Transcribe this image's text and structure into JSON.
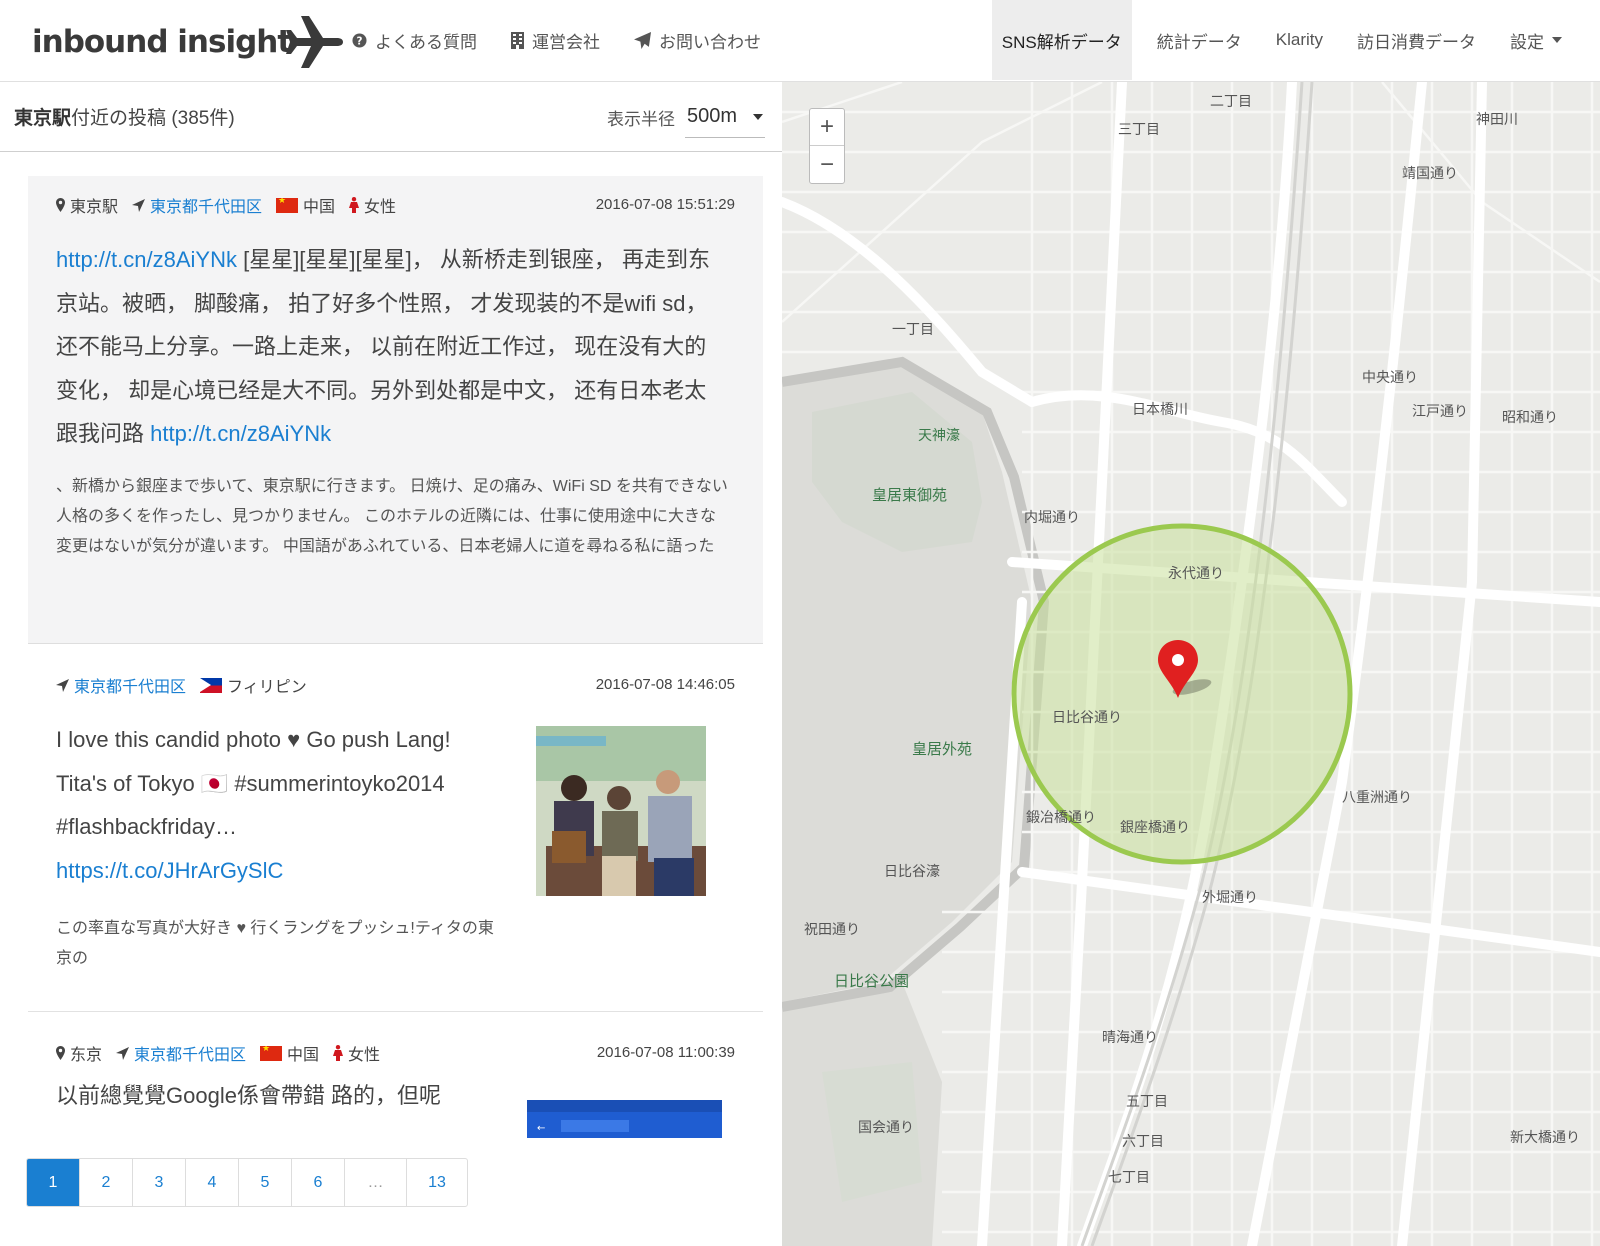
{
  "header": {
    "logo_text": "inbound insight",
    "nav_left": [
      {
        "label": "よくある質問",
        "icon": "question-circle-icon"
      },
      {
        "label": "運営会社",
        "icon": "building-icon"
      },
      {
        "label": "お問い合わせ",
        "icon": "paper-plane-icon"
      }
    ],
    "nav_right": [
      {
        "label": "SNS解析データ",
        "active": true
      },
      {
        "label": "統計データ"
      },
      {
        "label": "Klarity"
      },
      {
        "label": "訪日消費データ"
      },
      {
        "label": "設定",
        "dropdown": true
      }
    ]
  },
  "list": {
    "station": "東京駅",
    "title_suffix": "付近の投稿",
    "count": "(385件)",
    "radius_label": "表示半径",
    "radius_value": "500m"
  },
  "posts": [
    {
      "place": "東京駅",
      "area": "東京都千代田区",
      "country": "中国",
      "gender": "女性",
      "date": "2016-07-08 15:51:29",
      "link1": "http://t.cn/z8AiYNk",
      "text": " [星星][星星][星星]， 从新桥走到银座， 再走到东京站。被晒， 脚酸痛， 拍了好多个性照， 才发现装的不是wifi sd， 还不能马上分享。一路上走来， 以前在附近工作过， 现在没有大的变化， 却是心境已经是大不同。另外到处都是中文， 还有日本老太跟我问路 ",
      "link2": "http://t.cn/z8AiYNk",
      "translation": "、新橋から銀座まで歩いて、東京駅に行きます。 日焼け、足の痛み、WiFi SD を共有できない人格の多くを作ったし、見つかりません。 このホテルの近隣には、仕事に使用途中に大きな変更はないが気分が違います。 中国語があふれている、日本老婦人に道を尋ねる私に語った"
    },
    {
      "area": "東京都千代田区",
      "country": "フィリピン",
      "date": "2016-07-08 14:46:05",
      "text": "I love this candid photo ♥ Go push Lang! Tita's of Tokyo 🇯🇵 #summerintoyko2014 #flashbackfriday… ",
      "link": "https://t.co/JHrArGySlC",
      "translation": "この率直な写真が大好き ♥ 行くラングをプッシュ!ティタの東京の"
    },
    {
      "place": "东京",
      "area": "東京都千代田区",
      "country": "中国",
      "gender": "女性",
      "date": "2016-07-08 11:00:39",
      "text": "以前總覺覺Google係會帶錯 路的，但呢"
    }
  ],
  "pagination": [
    "1",
    "2",
    "3",
    "4",
    "5",
    "6",
    "…",
    "13"
  ],
  "map": {
    "zoom_in": "+",
    "zoom_out": "−",
    "labels": [
      {
        "text": "皇居東御苑"
      },
      {
        "text": "天神濠"
      },
      {
        "text": "皇居外苑"
      },
      {
        "text": "日比谷濠"
      },
      {
        "text": "日比谷公園"
      },
      {
        "text": "日本橋川"
      },
      {
        "text": "神田川"
      },
      {
        "text": "二丁目"
      },
      {
        "text": "三丁目"
      },
      {
        "text": "一丁目"
      },
      {
        "text": "永代通り"
      },
      {
        "text": "銀座橋通り"
      },
      {
        "text": "外堀通り"
      },
      {
        "text": "中央通り"
      },
      {
        "text": "昭和通り"
      },
      {
        "text": "日比谷通り"
      },
      {
        "text": "内堀通り"
      },
      {
        "text": "鍛冶橋通り"
      },
      {
        "text": "江戸通り"
      },
      {
        "text": "靖国通り"
      },
      {
        "text": "五丁目"
      },
      {
        "text": "六丁目"
      },
      {
        "text": "七丁目"
      },
      {
        "text": "祝田通り"
      },
      {
        "text": "晴海通り"
      },
      {
        "text": "新大橋通り"
      },
      {
        "text": "八重洲通り"
      },
      {
        "text": "国会通り"
      }
    ],
    "radius_color": "#9bc94f",
    "marker_color": "#e02020"
  },
  "colors": {
    "link": "#1a7fd1",
    "gender_icon": "#d0181e",
    "active_nav_bg": "#ededed"
  }
}
